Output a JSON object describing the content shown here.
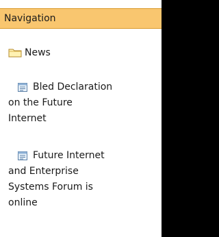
{
  "portlet": {
    "title": "Navigation"
  },
  "folder": {
    "label": "News",
    "icon": "folder-icon"
  },
  "items": [
    {
      "icon": "document-icon",
      "lines": [
        "Bled Declaration",
        "on the Future",
        "Internet"
      ]
    },
    {
      "icon": "document-icon",
      "lines": [
        "Future Internet",
        "and Enterprise",
        "Systems Forum is",
        "online"
      ]
    }
  ],
  "colors": {
    "header_bg": "#f9c66f",
    "header_border": "#d99a2c",
    "background": "#000000",
    "panel": "#ffffff"
  }
}
